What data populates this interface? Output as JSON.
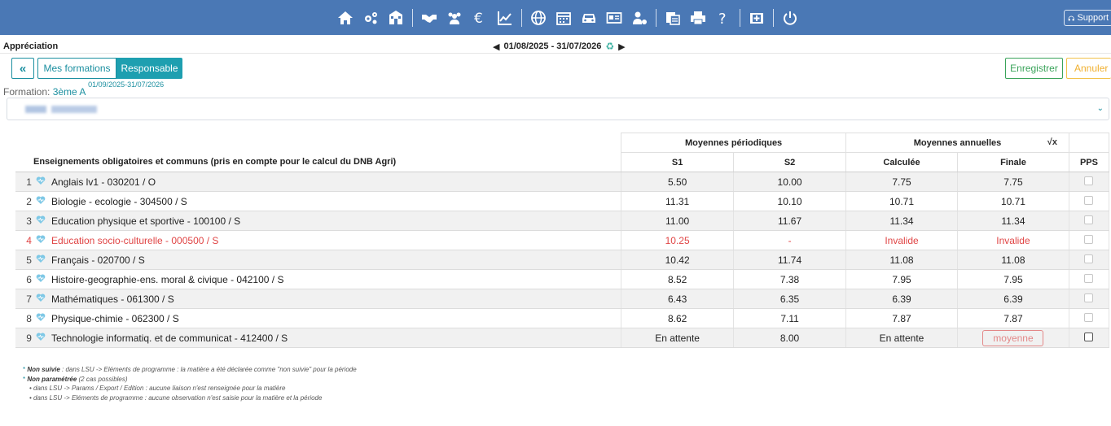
{
  "topbar": {
    "icons": [
      "home-icon",
      "gears-icon",
      "school-icon",
      "handshake-icon",
      "users-icon",
      "euro-icon",
      "chart-line-icon",
      "globe-icon",
      "calendar-icon",
      "car-icon",
      "id-card-icon",
      "user-settings-icon",
      "documents-icon",
      "print-icon",
      "help-icon",
      "first-aid-icon",
      "power-icon"
    ],
    "support_label": "Support"
  },
  "page": {
    "title": "Appréciation",
    "period_label": "01/08/2025  - 31/07/2026"
  },
  "buttons": {
    "back": "«",
    "mes_formations": "Mes formations",
    "responsable": "Responsable",
    "save": "Enregistrer",
    "cancel": "Annuler"
  },
  "formation": {
    "label": "Formation:",
    "value": "3ème A",
    "dates": "01/09/2025-31/07/2026"
  },
  "table": {
    "group_headers": {
      "periodic": "Moyennes périodiques",
      "annual": "Moyennes annuelles",
      "sqrt_symbol": "√x"
    },
    "headers": {
      "subject": "Enseignements obligatoires et communs (pris en compte pour le calcul du DNB Agri)",
      "s1": "S1",
      "s2": "S2",
      "calc": "Calculée",
      "finale": "Finale",
      "pps": "PPS"
    },
    "rows": [
      {
        "num": "1",
        "subject": "Anglais lv1 - 030201 / O",
        "s1": "5.50",
        "s2": "10.00",
        "calc": "7.75",
        "finale": "7.75"
      },
      {
        "num": "2",
        "subject": "Biologie - ecologie - 304500 / S",
        "s1": "11.31",
        "s2": "10.10",
        "calc": "10.71",
        "finale": "10.71"
      },
      {
        "num": "3",
        "subject": "Education physique et sportive - 100100 / S",
        "s1": "11.00",
        "s2": "11.67",
        "calc": "11.34",
        "finale": "11.34"
      },
      {
        "num": "4",
        "subject": "Education socio-culturelle - 000500 / S",
        "s1": "10.25",
        "s2": "-",
        "calc": "Invalide",
        "finale": "Invalide"
      },
      {
        "num": "5",
        "subject": "Français - 020700 / S",
        "s1": "10.42",
        "s2": "11.74",
        "calc": "11.08",
        "finale": "11.08"
      },
      {
        "num": "6",
        "subject": "Histoire-geographie-ens. moral & civique - 042100 / S",
        "s1": "8.52",
        "s2": "7.38",
        "calc": "7.95",
        "finale": "7.95"
      },
      {
        "num": "7",
        "subject": "Mathématiques - 061300 / S",
        "s1": "6.43",
        "s2": "6.35",
        "calc": "6.39",
        "finale": "6.39"
      },
      {
        "num": "8",
        "subject": "Physique-chimie - 062300 / S",
        "s1": "8.62",
        "s2": "7.11",
        "calc": "7.87",
        "finale": "7.87"
      },
      {
        "num": "9",
        "subject": "Technologie informatiq. et de communicat - 412400 / S",
        "s1": "En attente",
        "s2": "8.00",
        "calc": "En attente",
        "finale_placeholder": "moyenne"
      }
    ]
  },
  "notes": {
    "l1_key": "Non suivie",
    "l1_text": " : dans LSU -> Eléments de programme : la matière a été déclarée comme \"non suivie\" pour la période",
    "l2_key": "Non paramétrée",
    "l2_text": " (2 cas possibles)",
    "l3": "• dans LSU -> Params / Export / Edition : aucune liaison n'est renseignée pour la matière",
    "l4": "• dans LSU -> Eléments de programme : aucune observation n'est saisie pour la matière et la période"
  },
  "colors": {
    "navbar": "#4a78b5",
    "teal": "#1e9fb0",
    "save_green": "#3aa35a",
    "cancel_yellow": "#f0b030",
    "error_red": "#e04545"
  }
}
